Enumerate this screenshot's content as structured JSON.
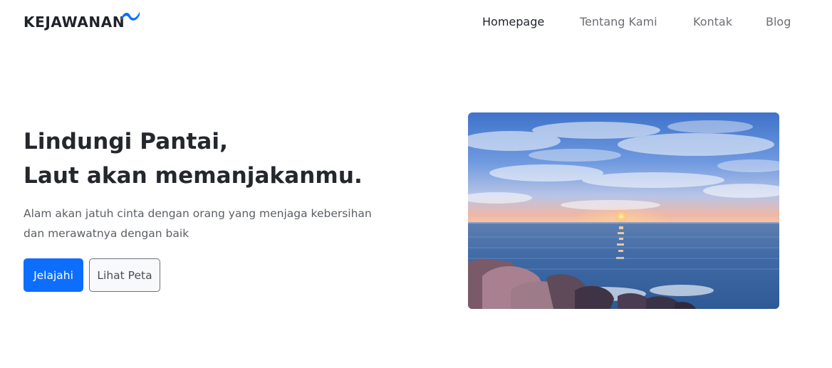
{
  "brand": {
    "name": "KEJAWANAN",
    "logo_icon": "wave-icon",
    "accent": "#0d6efd"
  },
  "nav": {
    "items": [
      {
        "label": "Homepage",
        "active": true
      },
      {
        "label": "Tentang Kami",
        "active": false
      },
      {
        "label": "Kontak",
        "active": false
      },
      {
        "label": "Blog",
        "active": false
      }
    ]
  },
  "hero": {
    "title_line1": "Lindungi Pantai,",
    "title_line2": "Laut akan memanjakanmu.",
    "description_line1": "Alam akan jatuh cinta dengan orang yang menjaga kebersihan",
    "description_line2": "dan merawatnya dengan baik",
    "primary_button": "Jelajahi",
    "secondary_button": "Lihat Peta",
    "image_subject": "sunset over sea with rocky shore"
  },
  "colors": {
    "primary": "#0d6efd",
    "text_dark": "#212529",
    "text_muted": "#6c757d"
  }
}
